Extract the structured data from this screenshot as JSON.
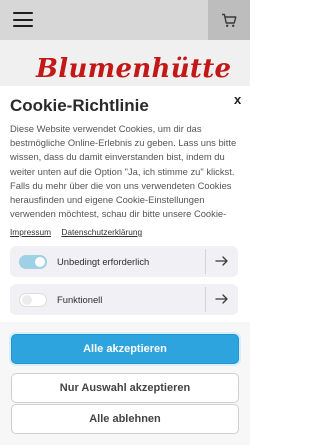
{
  "site": {
    "logo_text": "Blumenhütte"
  },
  "cookie": {
    "title": "Cookie-Richtlinie",
    "close_label": "x",
    "description": "Diese Website verwendet Cookies, um dir das bestmögliche Online-Erlebnis zu geben. Lass uns bitte wissen, dass du damit einverstanden bist, indem du weiter unten auf die Option \"Ja, ich stimme zu\" klickst. Falls du mehr über die von uns verwendeten Cookies herausfinden und eigene Cookie-Einstellungen verwenden möchtest, schau dir bitte unsere Cookie-",
    "links": {
      "impressum": "Impressum",
      "datenschutz": "Datenschutzerklärung"
    },
    "options": [
      {
        "label": "Unbedingt erforderlich",
        "enabled": true
      },
      {
        "label": "Funktionell",
        "enabled": false
      }
    ],
    "buttons": {
      "accept_all": "Alle akzeptieren",
      "accept_selection": "Nur Auswahl akzeptieren",
      "reject_all": "Alle ablehnen"
    }
  },
  "colors": {
    "brand_red": "#c21818",
    "accent_blue": "#2da4de"
  },
  "icons": {
    "menu": "hamburger-icon",
    "cart": "shopping-cart-icon",
    "arrow": "arrow-right-icon"
  }
}
